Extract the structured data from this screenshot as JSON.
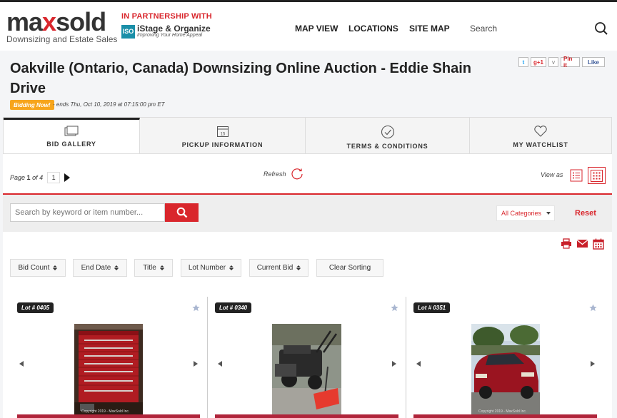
{
  "header": {
    "logo": {
      "word_a": "ma",
      "word_b": "x",
      "word_c": "sold",
      "tagline": "Downsizing and Estate Sales"
    },
    "partner": {
      "label": "IN PARTNERSHIP WITH",
      "badge": "ISO",
      "name": "iStage & Organize",
      "sub": "Improving Your Home Appeal"
    },
    "nav": [
      "MAP VIEW",
      "LOCATIONS",
      "SITE MAP"
    ],
    "search_label": "Search"
  },
  "auction": {
    "title": "Oakville (Ontario, Canada) Downsizing Online Auction - Eddie Shain Drive",
    "status_badge": "Bidding Now!",
    "ends_text": "- ends Thu, Oct 10, 2019 at 07:15:00 pm ET"
  },
  "social": {
    "twitter": "t",
    "gplus": "g+1",
    "down": "v",
    "pin": "Pin it",
    "like": "Like"
  },
  "tabs": [
    {
      "label": "BID GALLERY",
      "icon": "gallery-icon",
      "active": true
    },
    {
      "label": "PICKUP INFORMATION",
      "icon": "calendar-icon",
      "calendar_day": "15"
    },
    {
      "label": "TERMS & CONDITIONS",
      "icon": "check-circle-icon"
    },
    {
      "label": "MY WATCHLIST",
      "icon": "heart-icon"
    }
  ],
  "pager": {
    "prefix": "Page",
    "current": "1",
    "of_text": "of",
    "total": "4",
    "input_value": "1"
  },
  "refresh_label": "Refresh",
  "view_as_label": "View as",
  "search": {
    "placeholder": "Search by keyword or item number..."
  },
  "category": {
    "selected": "All Categories"
  },
  "reset_label": "Reset",
  "sort_buttons": [
    "Bid Count",
    "End Date",
    "Title",
    "Lot Number",
    "Current Bid",
    "Clear Sorting"
  ],
  "lots": [
    {
      "lot": "Lot # 0405",
      "copyright": "Copyright 2019 - MaxSold Inc."
    },
    {
      "lot": "Lot # 0340",
      "copyright": ""
    },
    {
      "lot": "Lot # 0351",
      "copyright": "Copyright 2019 - MaxSold Inc."
    }
  ],
  "colors": {
    "brand_red": "#d9262c",
    "badge_orange": "#f7a51c",
    "iso_teal": "#1a8fa8"
  }
}
